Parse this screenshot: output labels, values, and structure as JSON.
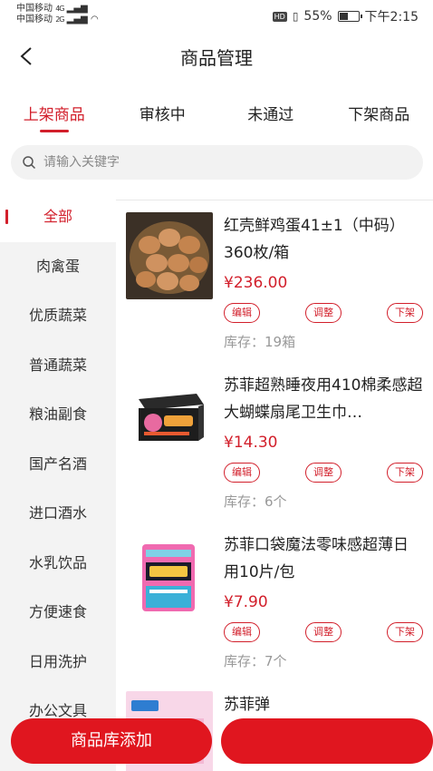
{
  "status_bar": {
    "carrier_1": "中国移动",
    "carrier_2": "中国移动",
    "signal_1": "4G",
    "signal_2": "2G",
    "hd": "HD",
    "battery": "55%",
    "battery_level": 0.55,
    "time": "下午2:15"
  },
  "header": {
    "title": "商品管理"
  },
  "tabs": [
    {
      "label": "上架商品",
      "active": true
    },
    {
      "label": "审核中"
    },
    {
      "label": "未通过"
    },
    {
      "label": "下架商品"
    }
  ],
  "search": {
    "placeholder": "请输入关键字",
    "value": ""
  },
  "categories": [
    {
      "label": "全部",
      "active": true
    },
    {
      "label": "肉禽蛋"
    },
    {
      "label": "优质蔬菜"
    },
    {
      "label": "普通蔬菜"
    },
    {
      "label": "粮油副食"
    },
    {
      "label": "国产名酒"
    },
    {
      "label": "进口酒水"
    },
    {
      "label": "水乳饮品"
    },
    {
      "label": "方便速食"
    },
    {
      "label": "日用洗护"
    },
    {
      "label": "办公文具"
    }
  ],
  "products": [
    {
      "name": "红壳鲜鸡蛋41±1（中码）360枚/箱",
      "price": "¥236.00",
      "stock": "库存：19箱",
      "image": "eggs-image"
    },
    {
      "name": "苏菲超熟睡夜用410棉柔感超大蝴蝶扇尾卫生巾…",
      "price": "¥14.30",
      "stock": "库存：6个",
      "image": "sanitary-pad-box-image"
    },
    {
      "name": "苏菲口袋魔法零味感超薄日用10片/包",
      "price": "¥7.90",
      "stock": "库存：7个",
      "image": "sanitary-pad-pack-image"
    },
    {
      "name": "苏菲弹",
      "image": "sanitary-pad-image"
    }
  ],
  "product_actions": {
    "edit": "编辑",
    "adjust": "调整",
    "off_shelf": "下架"
  },
  "bottom": {
    "library_add": "商品库添加",
    "second": ""
  },
  "colors": {
    "accent": "#d21f2b",
    "button": "#e0161f"
  }
}
